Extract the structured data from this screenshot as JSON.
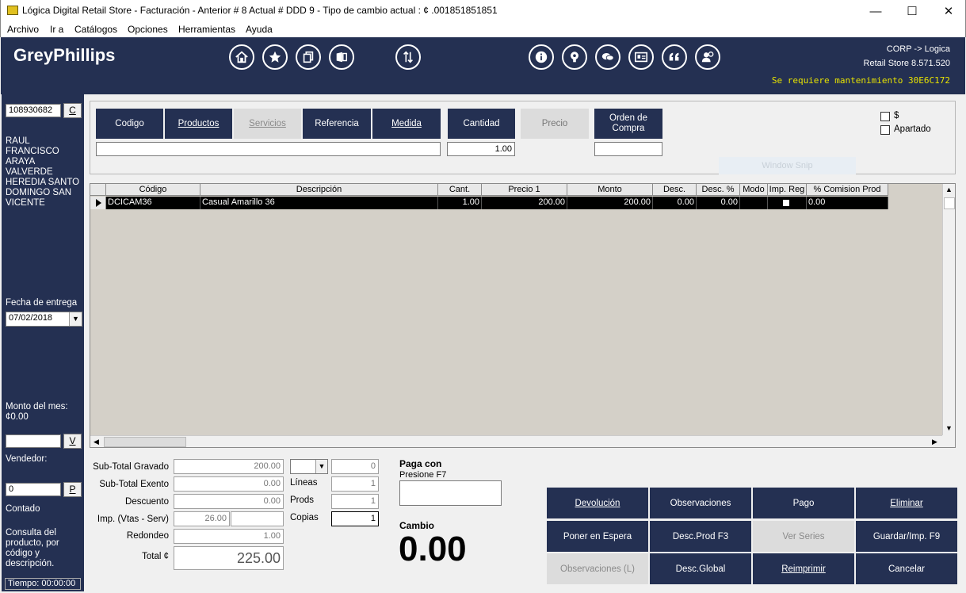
{
  "window": {
    "title": "Lógica Digital Retail Store - Facturación - Anterior # 8 Actual # DDD 9  - Tipo de cambio actual : ¢ .001851851851",
    "minimize": "—",
    "maximize": "☐",
    "close": "✕"
  },
  "menu": [
    "Archivo",
    "Ir a",
    "Catálogos",
    "Opciones",
    "Herramientas",
    "Ayuda"
  ],
  "header": {
    "brand": "GreyPhillips",
    "corp": "CORP -> Logica",
    "store": "Retail Store 8.571.520",
    "maintenance": "Se requiere mantenimiento 30E6C172"
  },
  "left": {
    "client_id": "108930682",
    "client_btn": "C",
    "client_name": "RAUL FRANCISCO ARAYA VALVERDE HEREDIA SANTO DOMINGO SAN VICENTE",
    "delivery_label": "Fecha de entrega",
    "delivery_date": "07/02/2018",
    "month_label": "Monto del mes:",
    "month_value": "¢0.00",
    "v_value": "",
    "v_btn": "V",
    "seller_label": "Vendedor:",
    "seller_value": "0",
    "seller_btn": "P",
    "payment_type": "Contado",
    "hint": "Consulta del producto, por código y descripción.",
    "timer": "Tiempo: 00:00:00"
  },
  "search": {
    "buttons": {
      "codigo": "Codigo",
      "productos": "Productos",
      "servicios": "Servicios",
      "referencia": "Referencia",
      "medida": "Medida",
      "cantidad": "Cantidad",
      "precio": "Precio",
      "orden": "Orden de Compra"
    },
    "search_value": "",
    "quantity_value": "1.00",
    "order_value": "",
    "check_dollar": "$",
    "check_apartado": "Apartado",
    "snip": "Window Snip"
  },
  "grid": {
    "columns": [
      "Código",
      "Descripción",
      "Cant.",
      "Precio 1",
      "Monto",
      "Desc.",
      "Desc. %",
      "Modo",
      "Imp. Reg",
      "% Comision Prod"
    ],
    "rows": [
      {
        "codigo": "DCICAM36",
        "descripcion": "Casual Amarillo 36",
        "cant": "1.00",
        "precio": "200.00",
        "monto": "200.00",
        "desc": "0.00",
        "desc_pct": "0.00",
        "modo": "",
        "comision": "0.00"
      }
    ]
  },
  "totals": {
    "subtotal_gravado_label": "Sub-Total Gravado",
    "subtotal_gravado": "200.00",
    "subtotal_exento_label": "Sub-Total Exento",
    "subtotal_exento": "0.00",
    "descuento_label": "Descuento",
    "descuento": "0.00",
    "impuesto_label": "Imp. (Vtas - Serv)",
    "impuesto": "26.00",
    "impuesto2": "",
    "redondeo_label": "Redondeo",
    "redondeo": "1.00",
    "total_label": "Total ¢",
    "total": "225.00",
    "combo_count": "0",
    "lineas_label": "Líneas",
    "lineas": "1",
    "prods_label": "Prods",
    "prods": "1",
    "copias_label": "Copias",
    "copias": "1"
  },
  "payment": {
    "paga_con_label": "Paga con",
    "press_f7": "Presione F7",
    "paga_con_value": "",
    "cambio_label": "Cambio",
    "cambio": "0.00"
  },
  "actions": {
    "devolucion": "Devolución",
    "observaciones": "Observaciones",
    "pago": "Pago",
    "eliminar": "Eliminar",
    "poner_espera": "Poner en Espera",
    "desc_prod": "Desc.Prod F3",
    "ver_series": "Ver Series",
    "guardar": "Guardar/Imp. F9",
    "observaciones_l": "Observaciones (L)",
    "desc_global": "Desc.Global",
    "reimprimir": "Reimprimir",
    "cancelar": "Cancelar"
  },
  "colors": {
    "navy": "#243052",
    "maintenance_text": "#e8e300"
  },
  "icons": [
    "home-icon",
    "star-icon",
    "copy-icon",
    "office-icon",
    "sort-icon",
    "info-icon",
    "idea-icon",
    "chat-icon",
    "contact-card-icon",
    "quote-icon",
    "support-icon"
  ]
}
